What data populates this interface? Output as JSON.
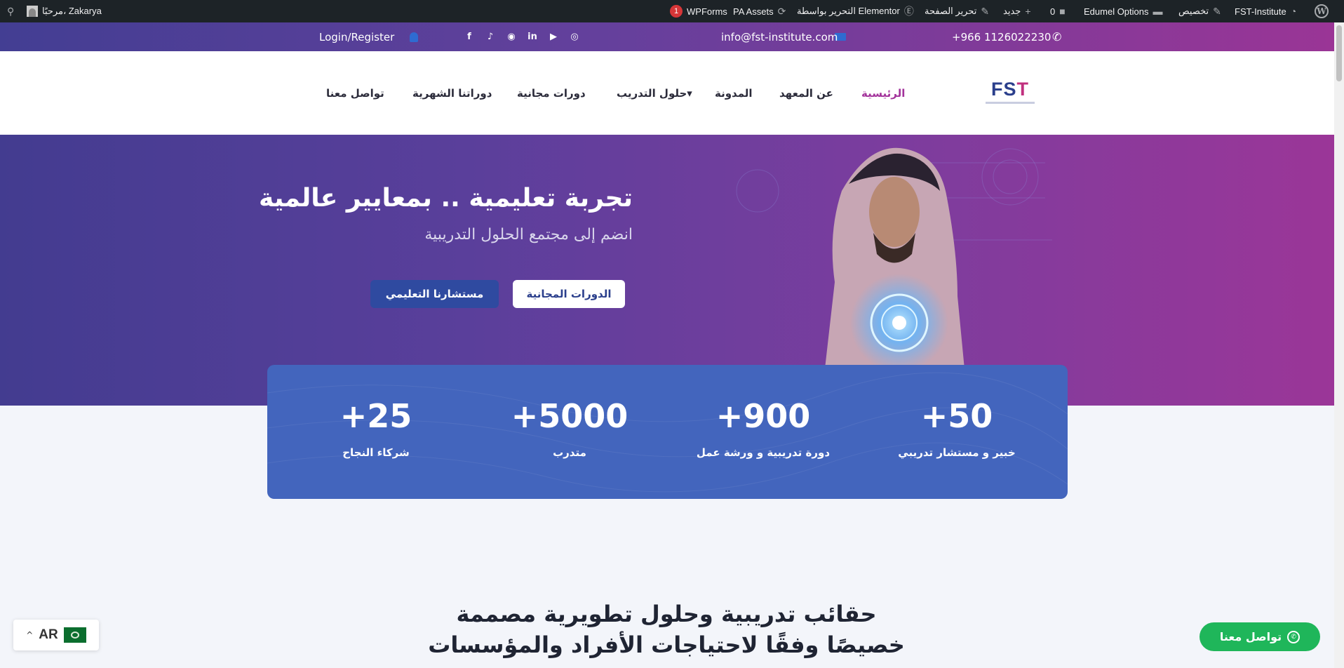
{
  "adminbar": {
    "site_name": "FST-Institute",
    "customize": "تخصيص",
    "edumel": "Edumel Options",
    "comments_count": "0",
    "new": "جديد",
    "edit_page": "تحرير الصفحة",
    "elementor": "التحرير بواسطة Elementor",
    "pa_assets": "PA Assets",
    "wpforms": "WPForms",
    "wpforms_badge": "1",
    "greeting": "مرحبًا، Zakarya"
  },
  "topbar": {
    "phone": "+966 1126022230",
    "email": "info@fst-institute.com",
    "login": "Login/Register",
    "social": [
      "f",
      "♪",
      "◉",
      "in",
      "▶",
      "◎"
    ]
  },
  "nav": {
    "logo_text_1": "FS",
    "logo_text_2": "T",
    "items": [
      {
        "label": "الرئيسية"
      },
      {
        "label": "عن المعهد"
      },
      {
        "label": "المدونة"
      },
      {
        "label": "حلول التدريب▾"
      },
      {
        "label": "دورات مجانية"
      },
      {
        "label": "دوراتنا الشهرية"
      },
      {
        "label": "تواصل معنا"
      }
    ]
  },
  "hero": {
    "title": "تجربة تعليمية .. بمعايير عالمية",
    "subtitle": "انضم إلى مجتمع الحلول التدريبية",
    "btn_free": "الدورات المجانية",
    "btn_consultant": "مستشارنا التعليمي"
  },
  "stats": [
    {
      "number": "+50",
      "label": "خبير و مستشار تدريبي"
    },
    {
      "number": "+900",
      "label": "دورة تدريبية و ورشة عمل"
    },
    {
      "number": "+5000",
      "label": "متدرب"
    },
    {
      "number": "+25",
      "label": "شركاء النجاح"
    }
  ],
  "section": {
    "line1": "حقائب تدريبية وحلول تطويرية مصممة",
    "line2": "خصيصًا وفقًا لاحتياجات الأفراد والمؤسسات"
  },
  "lang": {
    "code": "AR",
    "chevron": "^"
  },
  "whatsapp": {
    "label": "تواصل معنا",
    "icon": "✆"
  },
  "colors": {
    "accent": "#a3339b",
    "brand_blue": "#2f4aa0",
    "stats_bg": "#4365bd",
    "whatsapp": "#1fb65a"
  }
}
